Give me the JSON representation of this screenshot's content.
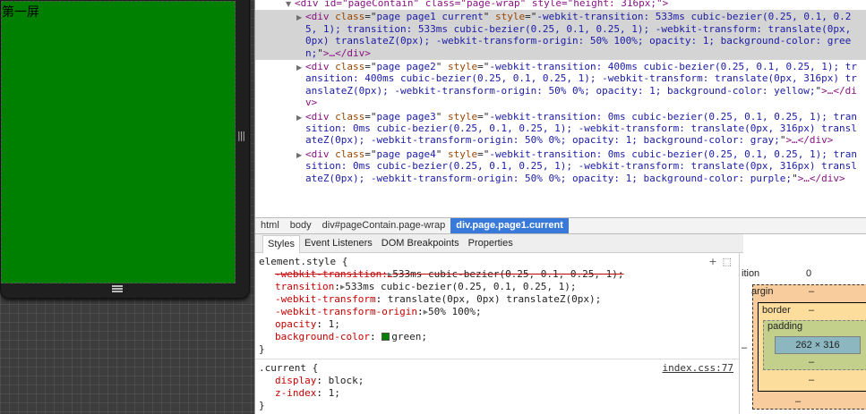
{
  "device": {
    "screen_text": "第一屏",
    "screen_color": "#008000"
  },
  "dom_tree": {
    "line0": "<div id=\"pageContain\" class=\"page-wrap\" style=\"height: 316px;\">",
    "page1": {
      "open": "<div ",
      "class_val": "page page1 current",
      "style_val": "-webkit-transition: 533ms cubic-bezier(0.25, 0.1, 0.25, 1); transition: 533ms cubic-bezier(0.25, 0.1, 0.25, 1); -webkit-transform: translate(0px, 0px) translateZ(0px); -webkit-transform-origin: 50% 100%; opacity: 1; background-color: green;",
      "close": ">…</div>"
    },
    "page2": {
      "open": "<div ",
      "class_val": "page page2",
      "style_val": "-webkit-transition: 400ms cubic-bezier(0.25, 0.1, 0.25, 1); transition: 400ms cubic-bezier(0.25, 0.1, 0.25, 1); -webkit-transform: translate(0px, 316px) translateZ(0px); -webkit-transform-origin: 50% 0%; opacity: 1; background-color: yellow;",
      "close": ">…</div>"
    },
    "page3": {
      "open": "<div ",
      "class_val": "page page3",
      "style_val": "-webkit-transition: 0ms cubic-bezier(0.25, 0.1, 0.25, 1); transition: 0ms cubic-bezier(0.25, 0.1, 0.25, 1); -webkit-transform: translate(0px, 316px) translateZ(0px); -webkit-transform-origin: 50% 0%; opacity: 1; background-color: gray;",
      "close": ">…</div>"
    },
    "page4": {
      "open": "<div ",
      "class_val": "page page4",
      "style_val": "-webkit-transition: 0ms cubic-bezier(0.25, 0.1, 0.25, 1); transition: 0ms cubic-bezier(0.25, 0.1, 0.25, 1); -webkit-transform: translate(0px, 316px) translateZ(0px); -webkit-transform-origin: 50% 0%; opacity: 1; background-color: purple;",
      "close": ">…</div>"
    }
  },
  "breadcrumb": [
    "html",
    "body",
    "div#pageContain.page-wrap",
    "div.page.page1.current"
  ],
  "sidebar_tabs": [
    "Styles",
    "Event Listeners",
    "DOM Breakpoints",
    "Properties"
  ],
  "styles": {
    "element_selector": "element.style {",
    "props": [
      {
        "name": "-webkit-transition",
        "value": "533ms cubic-bezier(0.25, 0.1, 0.25, 1);",
        "struck": true
      },
      {
        "name": "transition",
        "value": "533ms cubic-bezier(0.25, 0.1, 0.25, 1);",
        "struck": false
      },
      {
        "name": "-webkit-transform",
        "value": "translate(0px, 0px) translateZ(0px);",
        "struck": false
      },
      {
        "name": "-webkit-transform-origin",
        "value": "50% 100%;",
        "struck": false
      },
      {
        "name": "opacity",
        "value": "1;",
        "struck": false
      },
      {
        "name": "background-color",
        "value": "green;",
        "struck": false
      }
    ],
    "close_brace": "}",
    "current_selector": ".current {",
    "current_source": "index.css:77",
    "current_props": [
      {
        "name": "display",
        "value": "block;"
      },
      {
        "name": "z-index",
        "value": "1;"
      }
    ]
  },
  "metrics": {
    "transition_label": "ition",
    "transition_value": "0",
    "margin_label": "argin",
    "margin_value": "–",
    "border_label": "border",
    "border_value": "–",
    "padding_label": "padding",
    "padding_value": "–",
    "content_size": "262 × 316",
    "dash": "–"
  }
}
